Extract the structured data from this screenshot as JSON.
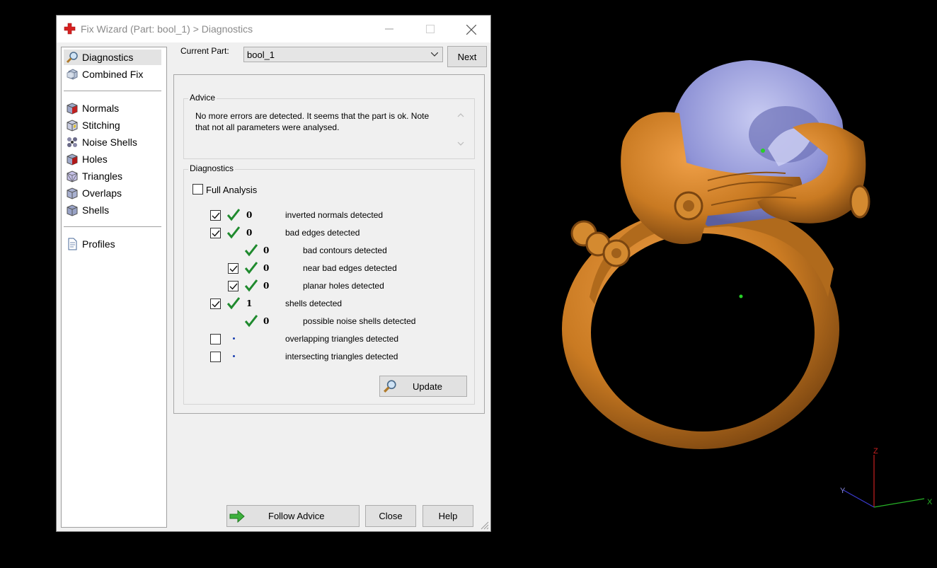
{
  "window": {
    "title": "Fix Wizard (Part: bool_1) > Diagnostics"
  },
  "sidebar": {
    "items_top": [
      {
        "label": "Diagnostics",
        "icon": "magnifier-icon"
      },
      {
        "label": "Combined Fix",
        "icon": "combined-fix-icon"
      }
    ],
    "items_mid": [
      {
        "label": "Normals",
        "icon": "normals-cube-icon"
      },
      {
        "label": "Stitching",
        "icon": "stitching-cube-icon"
      },
      {
        "label": "Noise Shells",
        "icon": "noise-shells-icon"
      },
      {
        "label": "Holes",
        "icon": "holes-cube-icon"
      },
      {
        "label": "Triangles",
        "icon": "triangles-cube-icon"
      },
      {
        "label": "Overlaps",
        "icon": "overlaps-cube-icon"
      },
      {
        "label": "Shells",
        "icon": "shells-cube-icon"
      }
    ],
    "items_bottom": [
      {
        "label": "Profiles",
        "icon": "profiles-document-icon"
      }
    ]
  },
  "current_part": {
    "label": "Current Part:",
    "value": "bool_1"
  },
  "buttons": {
    "next": "Next",
    "update": "Update",
    "follow_advice": "Follow Advice",
    "close": "Close",
    "help": "Help"
  },
  "advice": {
    "title": "Advice",
    "line1": "No more errors are detected. It seems that the part is ok. Note",
    "line2": "that not all parameters were analysed."
  },
  "diagnostics": {
    "title": "Diagnostics",
    "full_analysis": "Full Analysis",
    "rows": [
      {
        "checked": true,
        "status": "ok",
        "count": "0",
        "label": "inverted normals detected"
      },
      {
        "checked": true,
        "status": "ok",
        "count": "0",
        "label": "bad edges detected"
      },
      {
        "checked": null,
        "status": "ok",
        "count": "0",
        "label": "bad contours detected"
      },
      {
        "checked": true,
        "status": "ok",
        "count": "0",
        "label": "near bad edges detected"
      },
      {
        "checked": true,
        "status": "ok",
        "count": "0",
        "label": "planar holes detected"
      },
      {
        "checked": true,
        "status": "ok",
        "count": "1",
        "label": "shells detected"
      },
      {
        "checked": null,
        "status": "ok",
        "count": "0",
        "label": "possible noise shells detected"
      },
      {
        "checked": false,
        "status": "unknown",
        "count": "",
        "label": "overlapping triangles detected"
      },
      {
        "checked": false,
        "status": "unknown",
        "count": "",
        "label": "intersecting triangles detected"
      }
    ]
  },
  "axes": {
    "z": "Z",
    "y": "Y",
    "x": "X"
  },
  "colors": {
    "ring": "#c97a22",
    "skull": "#8f93d6",
    "ok_tick": "#1f8a2e",
    "axis_x": "#27b327",
    "axis_z": "#c82020",
    "axis_y": "#3b3bd0"
  }
}
